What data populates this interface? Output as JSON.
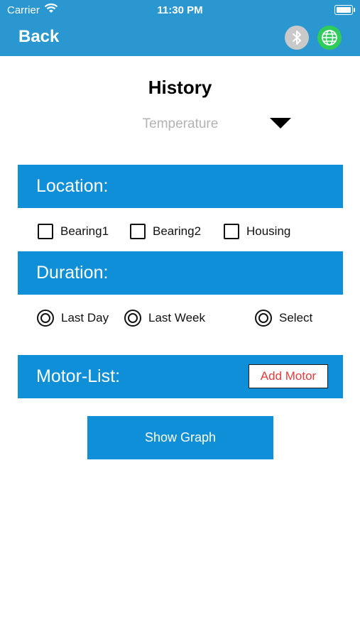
{
  "status_bar": {
    "carrier": "Carrier",
    "time": "11:30 PM"
  },
  "nav": {
    "back_label": "Back"
  },
  "page": {
    "title": "History"
  },
  "measurement": {
    "selected": "Temperature"
  },
  "location": {
    "header": "Location:",
    "options": [
      "Bearing1",
      "Bearing2",
      "Housing"
    ]
  },
  "duration": {
    "header": "Duration:",
    "options": [
      "Last Day",
      "Last Week",
      "Select"
    ]
  },
  "motor_list": {
    "header": "Motor-List:",
    "add_label": "Add Motor"
  },
  "actions": {
    "show_graph_label": "Show Graph"
  },
  "colors": {
    "nav_bar": "#2b97d0",
    "section_band": "#0f8fd8",
    "add_motor_text": "#e83a3a",
    "bluetooth_icon_bg": "#c9c9c9",
    "globe_icon_bg": "#2fcc5a"
  }
}
